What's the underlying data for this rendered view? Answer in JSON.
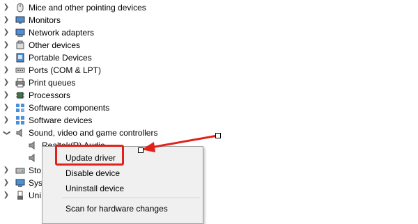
{
  "tree": {
    "items": [
      {
        "label": "Mice and other pointing devices",
        "icon": "mouse-icon",
        "expanded": false
      },
      {
        "label": "Monitors",
        "icon": "monitor-icon",
        "expanded": false
      },
      {
        "label": "Network adapters",
        "icon": "network-adapter-icon",
        "expanded": false
      },
      {
        "label": "Other devices",
        "icon": "unknown-device-icon",
        "expanded": false
      },
      {
        "label": "Portable Devices",
        "icon": "portable-device-icon",
        "expanded": false
      },
      {
        "label": "Ports (COM & LPT)",
        "icon": "port-icon",
        "expanded": false
      },
      {
        "label": "Print queues",
        "icon": "printer-icon",
        "expanded": false
      },
      {
        "label": "Processors",
        "icon": "processor-icon",
        "expanded": false
      },
      {
        "label": "Software components",
        "icon": "software-component-icon",
        "expanded": false
      },
      {
        "label": "Software devices",
        "icon": "software-device-icon",
        "expanded": false
      },
      {
        "label": "Sound, video and game controllers",
        "icon": "speaker-icon",
        "expanded": true
      }
    ],
    "children": [
      {
        "label": "Realtek(R) Audio",
        "icon": "speaker-icon"
      },
      {
        "label": "",
        "icon": "speaker-icon"
      }
    ],
    "truncated_items": [
      {
        "label": "Sto",
        "icon": "storage-icon"
      },
      {
        "label": "Sys",
        "icon": "system-icon"
      },
      {
        "label": "Uni",
        "icon": "usb-icon"
      }
    ]
  },
  "context_menu": {
    "items": [
      {
        "label": "Update driver"
      },
      {
        "label": "Disable device"
      },
      {
        "label": "Uninstall device"
      },
      {
        "label": "Scan for hardware changes"
      }
    ]
  },
  "colors": {
    "highlight": "#e0221b",
    "menu_bg": "#f0f0f0"
  }
}
